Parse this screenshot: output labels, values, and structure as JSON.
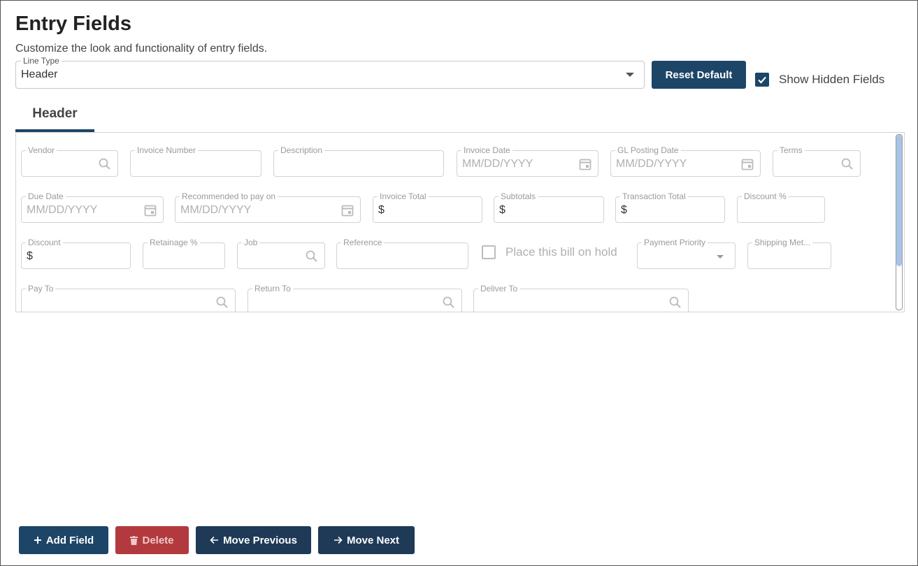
{
  "header": {
    "title": "Entry Fields",
    "subtitle": "Customize the look and functionality of entry fields."
  },
  "line_type": {
    "label": "Line Type",
    "value": "Header"
  },
  "reset_default_label": "Reset Default",
  "show_hidden": {
    "label": "Show Hidden Fields",
    "checked": true
  },
  "tab_label": "Header",
  "fields": {
    "vendor": {
      "label": "Vendor"
    },
    "invoice_number": {
      "label": "Invoice Number"
    },
    "description": {
      "label": "Description"
    },
    "invoice_date": {
      "label": "Invoice Date",
      "placeholder": "MM/DD/YYYY"
    },
    "gl_posting_date": {
      "label": "GL Posting Date",
      "placeholder": "MM/DD/YYYY"
    },
    "terms": {
      "label": "Terms"
    },
    "due_date": {
      "label": "Due Date",
      "placeholder": "MM/DD/YYYY"
    },
    "recommended_pay": {
      "label": "Recommended to pay on",
      "placeholder": "MM/DD/YYYY"
    },
    "invoice_total": {
      "label": "Invoice Total",
      "prefix": "$"
    },
    "subtotals": {
      "label": "Subtotals",
      "prefix": "$"
    },
    "transaction_total": {
      "label": "Transaction Total",
      "prefix": "$"
    },
    "discount_pct": {
      "label": "Discount %"
    },
    "discount": {
      "label": "Discount",
      "prefix": "$"
    },
    "retainage_pct": {
      "label": "Retainage %"
    },
    "job": {
      "label": "Job"
    },
    "reference": {
      "label": "Reference"
    },
    "hold": {
      "label": "Place this bill on hold",
      "checked": false
    },
    "payment_priority": {
      "label": "Payment Priority"
    },
    "shipping_method": {
      "label": "Shipping Met..."
    },
    "pay_to": {
      "label": "Pay To"
    },
    "return_to": {
      "label": "Return To"
    },
    "deliver_to": {
      "label": "Deliver To"
    }
  },
  "footer": {
    "add_field": "Add Field",
    "delete": "Delete",
    "move_previous": "Move Previous",
    "move_next": "Move Next"
  },
  "icons": {
    "search": "search-icon",
    "calendar": "calendar-icon",
    "plus": "plus-icon",
    "trash": "trash-icon",
    "arrow_left": "arrow-left-icon",
    "arrow_right": "arrow-right-icon",
    "check": "check-icon"
  },
  "colors": {
    "primary": "#1d4567",
    "dark": "#1e3a56",
    "danger": "#b23a3e",
    "scroll_thumb": "#a9c4e6"
  }
}
